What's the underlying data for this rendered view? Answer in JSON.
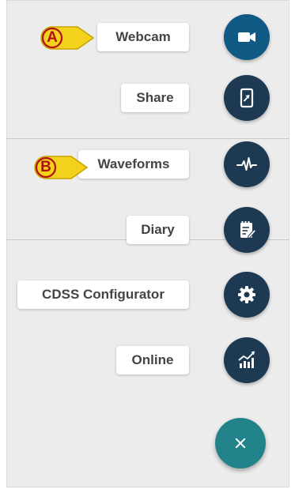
{
  "actions": [
    {
      "label": "Webcam",
      "icon": "video-camera-icon",
      "active": true
    },
    {
      "label": "Share",
      "icon": "tablet-share-icon"
    },
    {
      "label": "Waveforms",
      "icon": "waveform-icon"
    },
    {
      "label": "Diary",
      "icon": "notepad-icon"
    },
    {
      "label": "CDSS Configurator",
      "icon": "gear-icon"
    },
    {
      "label": "Online",
      "icon": "bar-chart-trend-icon"
    }
  ],
  "main_fab": {
    "icon": "close-icon"
  },
  "callouts": [
    {
      "letter": "A",
      "points_to": "Webcam"
    },
    {
      "letter": "B",
      "points_to": "Waveforms"
    }
  ],
  "colors": {
    "fab": "#1e3a52",
    "fab_active": "#0f5a84",
    "main_fab": "#23838a",
    "panel_bg": "#ececec",
    "callout_fill": "#f2d21a",
    "callout_text": "#b01010"
  }
}
